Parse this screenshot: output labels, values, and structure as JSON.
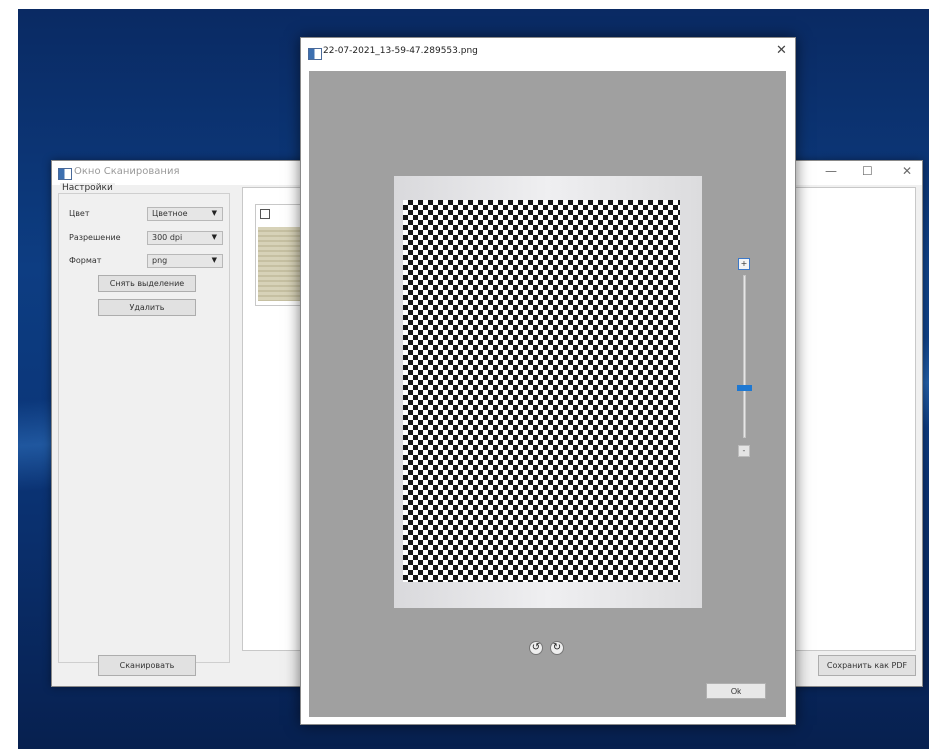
{
  "scan_window": {
    "title": "Окно Сканирования",
    "controls": {
      "minimize": "—",
      "maximize": "☐",
      "close": "✕"
    },
    "settings": {
      "group_title": "Настройки",
      "color_label": "Цвет",
      "color_value": "Цветное",
      "resolution_label": "Разрешение",
      "resolution_value": "300 dpi",
      "format_label": "Формат",
      "format_value": "png",
      "deselect_button": "Снять выделение",
      "delete_button": "Удалить"
    },
    "scan_button": "Сканировать",
    "save_pdf_button": "Сохранить как PDF"
  },
  "image_dialog": {
    "title": "22-07-2021_13-59-47.289553.png",
    "close": "✕",
    "zoom_in": "+",
    "zoom_out": "-",
    "zoom_level": 0.3,
    "rotate_left_icon": "↺",
    "rotate_right_icon": "↻",
    "ok_button": "Ok"
  }
}
